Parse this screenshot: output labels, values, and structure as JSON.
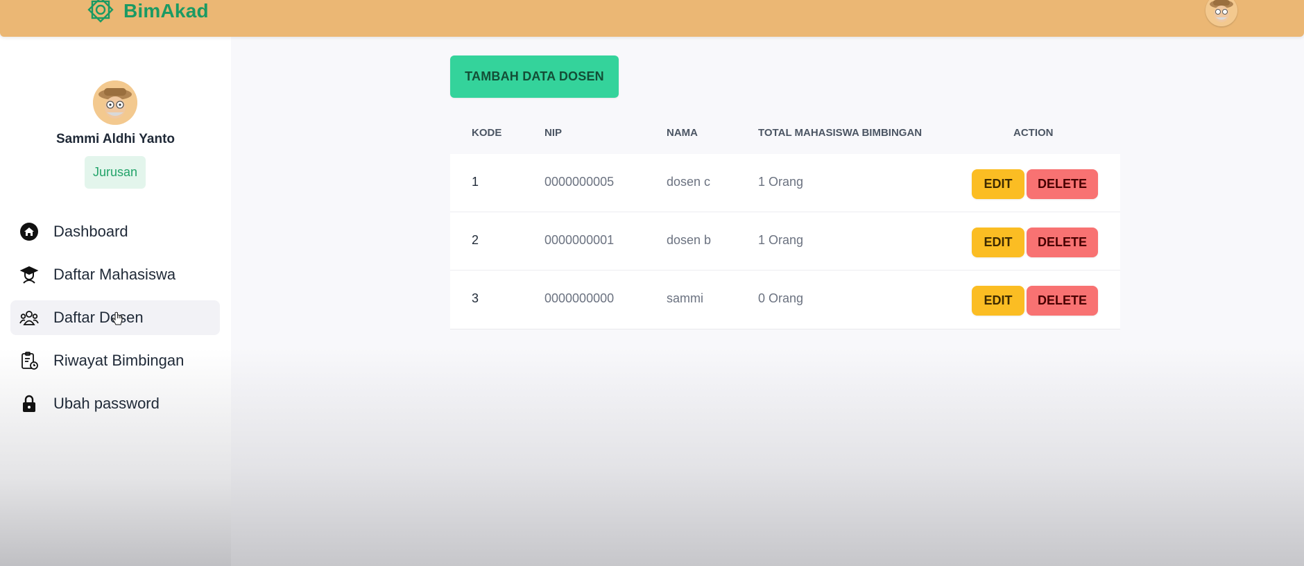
{
  "app": {
    "brand_name": "BimAkad",
    "brand_color": "#1b9a63",
    "header_color": "#ebb774"
  },
  "profile": {
    "name": "Sammi Aldhi Yanto",
    "role": "Jurusan"
  },
  "sidebar": {
    "items": [
      {
        "label": "Dashboard",
        "icon": "home-icon",
        "active": false
      },
      {
        "label": "Daftar Mahasiswa",
        "icon": "student-icon",
        "active": false
      },
      {
        "label": "Daftar Dosen",
        "icon": "users-icon",
        "active": true
      },
      {
        "label": "Riwayat Bimbingan",
        "icon": "clipboard-clock-icon",
        "active": false
      },
      {
        "label": "Ubah password",
        "icon": "lock-icon",
        "active": false
      }
    ]
  },
  "main": {
    "add_button_label": "TAMBAH DATA DOSEN",
    "table": {
      "headers": {
        "kode": "KODE",
        "nip": "NIP",
        "nama": "NAMA",
        "total": "TOTAL MAHASISWA BIMBINGAN",
        "action": "ACTION"
      },
      "rows": [
        {
          "kode": "1",
          "nip": "0000000005",
          "nama": "dosen c",
          "total": "1 Orang"
        },
        {
          "kode": "2",
          "nip": "0000000001",
          "nama": "dosen b",
          "total": "1 Orang"
        },
        {
          "kode": "3",
          "nip": "0000000000",
          "nama": "sammi",
          "total": "0 Orang"
        }
      ],
      "edit_label": "EDIT",
      "delete_label": "DELETE"
    }
  },
  "colors": {
    "add_button": "#34d39b",
    "edit_button": "#fbbd23",
    "delete_button": "#f87272",
    "badge_bg": "#e3f5ec",
    "badge_text": "#22a369"
  }
}
